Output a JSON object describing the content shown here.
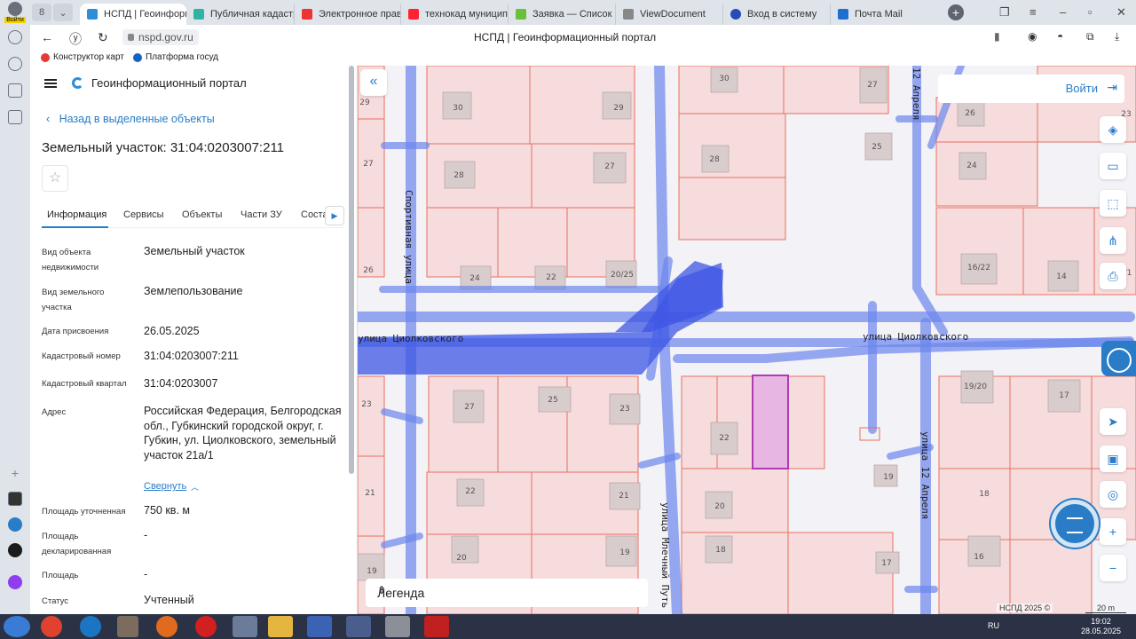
{
  "browser": {
    "user_label": "Войти",
    "tabs": [
      {
        "label": "НСПД | Геоинформ",
        "active": true,
        "icon_color": "#2d8ed8"
      },
      {
        "label": "Публичная кадастр",
        "active": false,
        "icon_color": "#2db5a3"
      },
      {
        "label": "Электронное прав",
        "active": false,
        "icon_color": "#e33"
      },
      {
        "label": "технокад муниципа",
        "active": false,
        "icon_color": "#f23"
      },
      {
        "label": "Заявка — Список за",
        "active": false,
        "icon_color": "#6bbf3a"
      },
      {
        "label": "ViewDocument",
        "active": false,
        "icon_color": "#888"
      },
      {
        "label": "Вход в систему",
        "active": false,
        "icon_color": "#2a4bb5"
      },
      {
        "label": "Почта Mail",
        "active": false,
        "icon_color": "#1f6fd1"
      }
    ],
    "tab_close": "×",
    "new_tab": "+",
    "url": "nspd.gov.ru",
    "page_title": "НСПД | Геоинформационный портал",
    "bookmarks": [
      {
        "label": "Конструктор карт",
        "icon_color": "#e53935"
      },
      {
        "label": "Платформа госуд",
        "icon_color": "#1565c0"
      }
    ]
  },
  "panel": {
    "brand": "Геоинформационный портал",
    "back_link": "Назад в выделенные объекты",
    "title": "Земельный участок: 31:04:0203007:211",
    "tabs": [
      "Информация",
      "Сервисы",
      "Объекты",
      "Части ЗУ",
      "Соста"
    ],
    "rows": [
      {
        "label": "Вид объекта недвижимости",
        "value": "Земельный участок"
      },
      {
        "label": "Вид земельного участка",
        "value": "Землепользование"
      },
      {
        "label": "Дата присвоения",
        "value": "26.05.2025"
      },
      {
        "label": "Кадастровый номер",
        "value": "31:04:0203007:211"
      },
      {
        "label": "Кадастровый квартал",
        "value": "31:04:0203007"
      },
      {
        "label": "Адрес",
        "value": "Российская Федерация, Белгородская обл., Губкинский городской округ, г. Губкин, ул. Циолковского, земельный участок 21а/1"
      },
      {
        "label": "Площадь уточненная",
        "value": "750 кв. м"
      },
      {
        "label": "Площадь декларированная",
        "value": "-"
      },
      {
        "label": "Площадь",
        "value": "-"
      },
      {
        "label": "Статус",
        "value": "Учтенный"
      }
    ],
    "collapse_link": "Свернуть"
  },
  "map": {
    "login_label": "Войти",
    "legend_label": "Легенда",
    "copyright": "НСПД 2025 ©",
    "scale": "20 m",
    "streets": {
      "tsiolkovskogo": "улица Циолковского",
      "sportivnaya": "Спортивная улица",
      "mlechny": "улица Млечный Путь",
      "aprelya": "улица 12 Апреля",
      "aprelya_top": "12 Апреля"
    },
    "lot_numbers": [
      "29",
      "30",
      "29",
      "30",
      "27",
      "26",
      "28",
      "27",
      "28",
      "25",
      "24",
      "27",
      "26",
      "24",
      "22",
      "20/25",
      "16/22",
      "14",
      "/1",
      "23",
      "23",
      "27",
      "25",
      "23",
      "22",
      "19/20",
      "17",
      "21",
      "22",
      "21",
      "20",
      "19",
      "18",
      "19",
      "20",
      "19",
      "18",
      "17",
      "16"
    ],
    "selected_color": "#c06dc0",
    "road_color": "#4a6ce8"
  },
  "taskbar": {
    "lang": "RU",
    "time": "19:02",
    "date": "28.05.2025"
  }
}
